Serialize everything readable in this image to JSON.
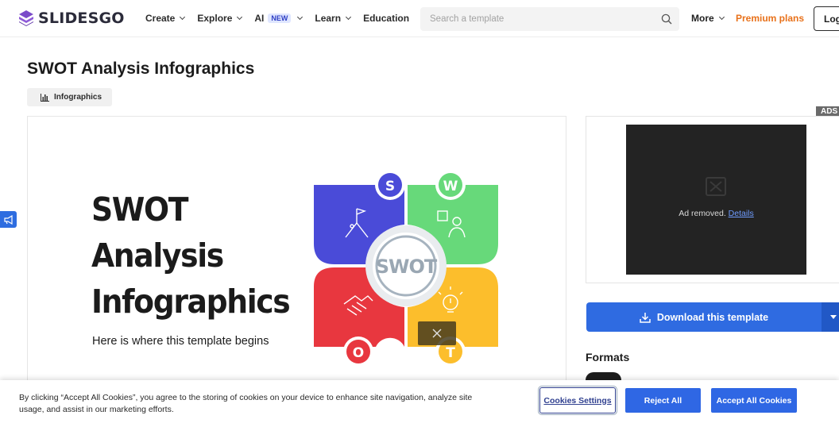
{
  "brand": {
    "name": "SLIDESGO",
    "accent": "#2f6be1",
    "premium_color": "#e8711a"
  },
  "nav": {
    "items": [
      {
        "label": "Create",
        "has_dropdown": true
      },
      {
        "label": "Explore",
        "has_dropdown": true
      },
      {
        "label": "AI",
        "badge": "NEW",
        "has_dropdown": true
      },
      {
        "label": "Learn",
        "has_dropdown": true
      },
      {
        "label": "Education",
        "has_dropdown": false
      }
    ],
    "search_placeholder": "Search a template",
    "more_label": "More",
    "premium_label": "Premium plans",
    "login_label": "Log"
  },
  "page": {
    "title": "SWOT Analysis Infographics",
    "tag": "Infographics",
    "tag_icon": "bar-chart-icon"
  },
  "preview": {
    "title_lines": [
      "SWOT",
      "Analysis",
      "Infographics"
    ],
    "subtitle": "Here is where this template begins",
    "center_label": "SWOT",
    "quadrants": [
      {
        "letter": "S",
        "color": "#4a4bd8",
        "icon": "flag-mountain-icon"
      },
      {
        "letter": "W",
        "color": "#67d97a",
        "icon": "person-puzzle-icon"
      },
      {
        "letter": "O",
        "color": "#e8373f",
        "icon": "handshake-icon"
      },
      {
        "letter": "T",
        "color": "#fcbe2c",
        "icon": "lightbulb-icon"
      }
    ]
  },
  "ad": {
    "corner_label": "ADS",
    "text": "Ad removed.",
    "link": "Details"
  },
  "download": {
    "label": "Download this template"
  },
  "formats_label": "Formats",
  "cookie": {
    "text": "By clicking “Accept All Cookies”, you agree to the storing of cookies on your device to enhance site navigation, analyze site usage, and assist in our marketing efforts.",
    "settings_label": "Cookies Settings",
    "reject_label": "Reject All",
    "accept_label": "Accept All Cookies"
  }
}
